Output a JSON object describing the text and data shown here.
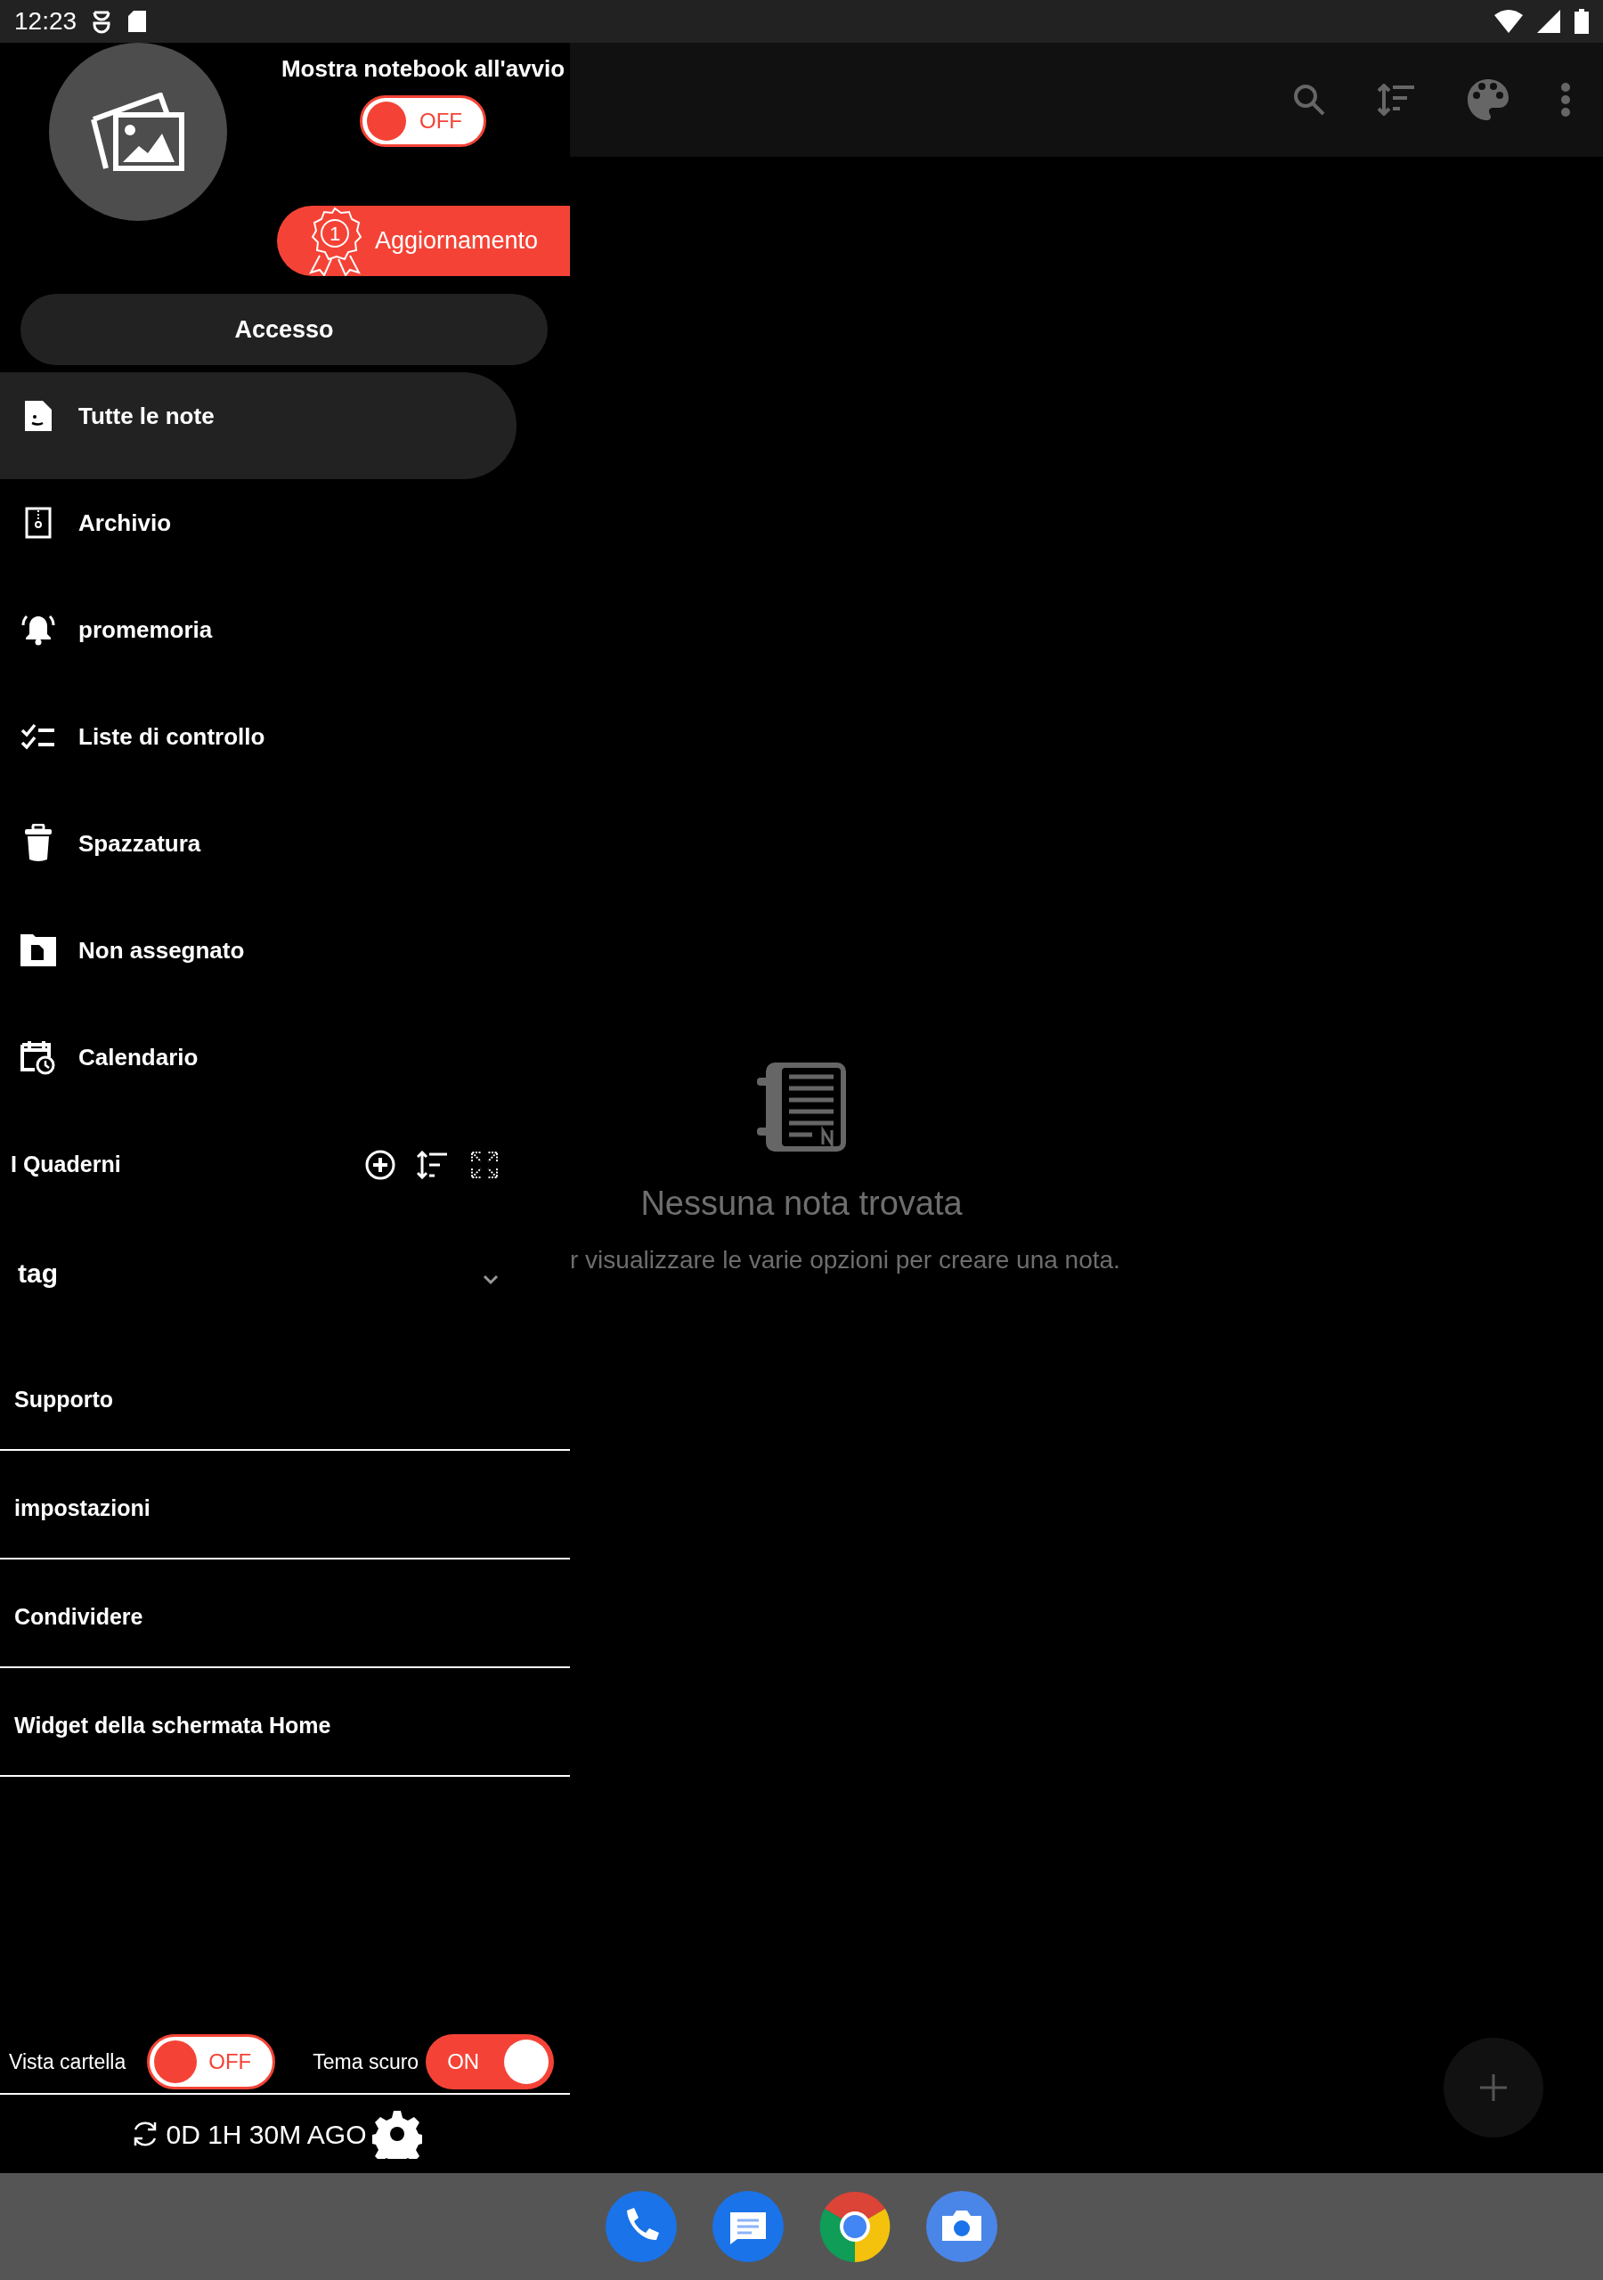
{
  "status_bar": {
    "time": "12:23"
  },
  "drawer": {
    "show_notebook": {
      "label": "Mostra notebook all'avvio",
      "on": false,
      "state_text": "OFF"
    },
    "upgrade_button": {
      "label": "Aggiornamento",
      "award_number": "1"
    },
    "login_button": "Accesso",
    "menu": [
      {
        "label": "Tutte le note",
        "selected": true
      },
      {
        "label": "Archivio",
        "selected": false
      },
      {
        "label": "promemoria",
        "selected": false
      },
      {
        "label": "Liste di controllo",
        "selected": false
      },
      {
        "label": "Spazzatura",
        "selected": false
      },
      {
        "label": "Non assegnato",
        "selected": false
      },
      {
        "label": "Calendario",
        "selected": false
      }
    ],
    "notebooks": {
      "title": "I Quaderni"
    },
    "tags": {
      "title": "tag",
      "expanded": false
    },
    "links": [
      "Supporto",
      "impostazioni",
      "Condividere",
      "Widget della schermata Home"
    ],
    "toggles": [
      {
        "label": "Vista cartella",
        "on": false,
        "state_text": "OFF"
      },
      {
        "label": "Tema scuro",
        "on": true,
        "state_text": "ON"
      }
    ],
    "sync": {
      "text": "0D 1H 30M AGO"
    }
  },
  "empty_state": {
    "title": "Nessuna nota trovata",
    "hint": "r visualizzare le varie opzioni per creare una nota."
  }
}
